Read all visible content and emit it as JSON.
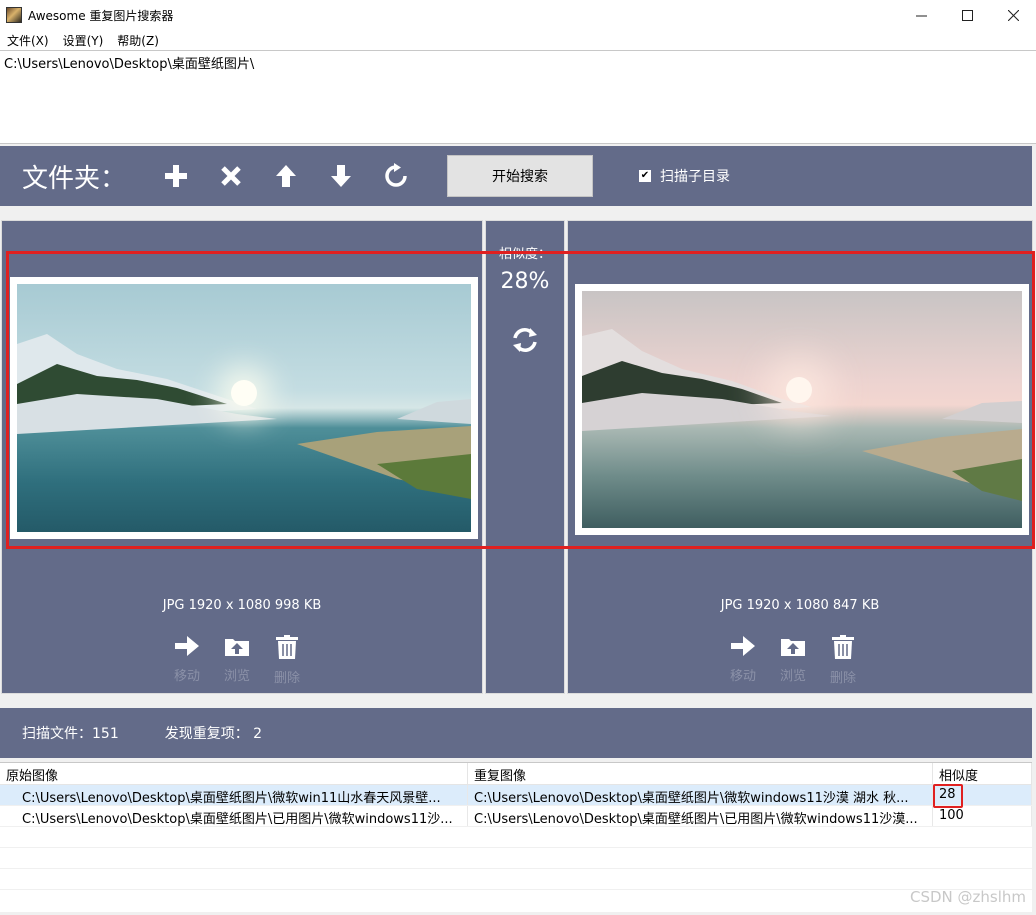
{
  "window": {
    "title": "Awesome 重复图片搜索器",
    "controls": [
      "minimize-icon",
      "maximize-icon",
      "close-icon"
    ]
  },
  "menu": {
    "items": [
      {
        "label": "文件(X)"
      },
      {
        "label": "设置(Y)"
      },
      {
        "label": "帮助(Z)"
      }
    ]
  },
  "path_list": {
    "entries": [
      "C:\\Users\\Lenovo\\Desktop\\桌面壁纸图片\\"
    ]
  },
  "toolbar": {
    "folder_label": "文件夹：",
    "icons": [
      "add-icon",
      "remove-icon",
      "arrow-up-icon",
      "arrow-down-icon",
      "refresh-icon"
    ],
    "search_label": "开始搜索",
    "scan_subdir_label": "扫描子目录",
    "scan_subdir_checked": true
  },
  "compare": {
    "left": {
      "info": "JPG  1920 x 1080  998 KB",
      "actions": [
        {
          "label": "移动",
          "icon": "arrow-right-icon"
        },
        {
          "label": "浏览",
          "icon": "folder-upload-icon"
        },
        {
          "label": "删除",
          "icon": "trash-icon"
        }
      ]
    },
    "similarity_label": "相似度：",
    "similarity_value": "28%",
    "right": {
      "info": "JPG  1920 x 1080  847 KB",
      "actions": [
        {
          "label": "移动",
          "icon": "arrow-right-icon"
        },
        {
          "label": "浏览",
          "icon": "folder-upload-icon"
        },
        {
          "label": "删除",
          "icon": "trash-icon"
        }
      ]
    }
  },
  "status": {
    "scanned": "扫描文件：151",
    "duplicates": "发现重复项： 2"
  },
  "table": {
    "headers": [
      "原始图像",
      "重复图像",
      "相似度"
    ],
    "rows": [
      {
        "original": "C:\\Users\\Lenovo\\Desktop\\桌面壁纸图片\\微软win11山水春天风景壁...",
        "duplicate": "C:\\Users\\Lenovo\\Desktop\\桌面壁纸图片\\微软windows11沙漠 湖水 秋...",
        "similarity": "28"
      },
      {
        "original": "C:\\Users\\Lenovo\\Desktop\\桌面壁纸图片\\已用图片\\微软windows11沙...",
        "duplicate": "C:\\Users\\Lenovo\\Desktop\\桌面壁纸图片\\已用图片\\微软windows11沙漠...",
        "similarity": "100"
      }
    ]
  },
  "watermark": "CSDN @zhslhm",
  "colors": {
    "panel": "#636b89",
    "highlight_box": "#e02020",
    "selected_row": "#dcecfb"
  }
}
